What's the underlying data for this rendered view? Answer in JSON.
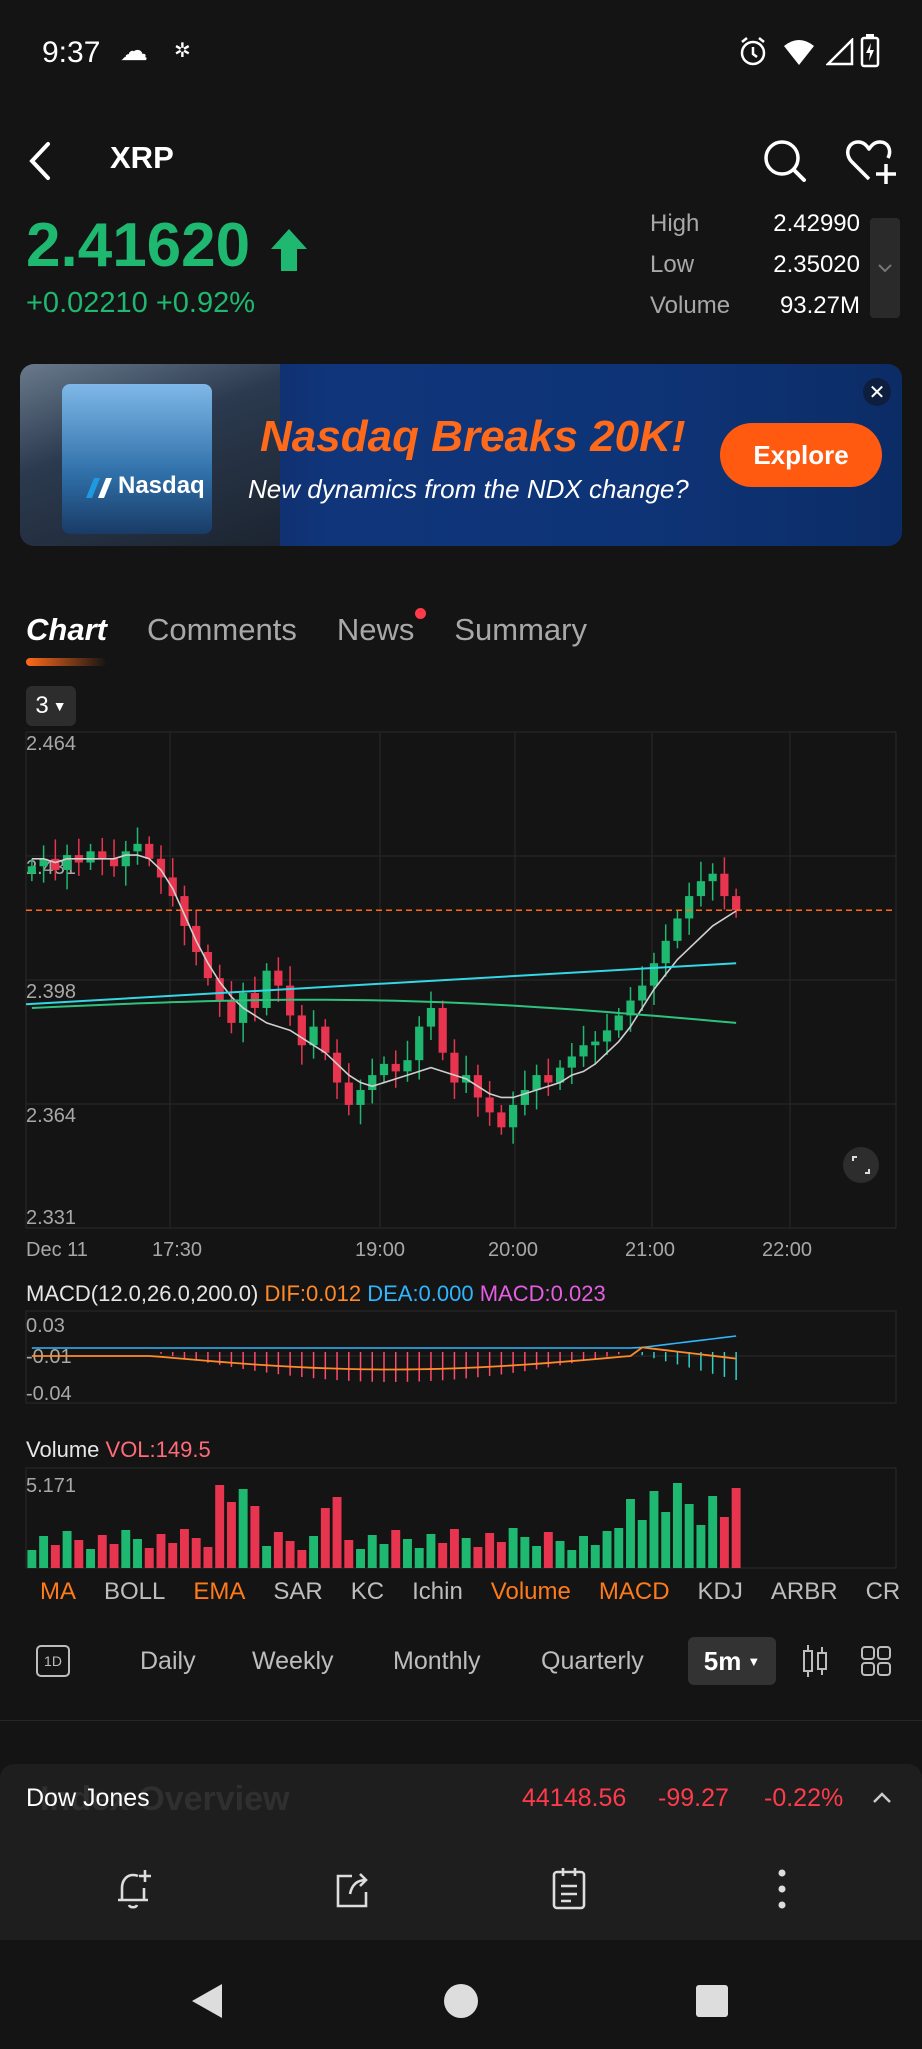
{
  "status_bar": {
    "time": "9:37"
  },
  "header": {
    "title": "XRP"
  },
  "quote": {
    "price": "2.41620",
    "change": "+0.02210 +0.92%",
    "stats": [
      {
        "label": "High",
        "value": "2.42990"
      },
      {
        "label": "Low",
        "value": "2.35020"
      },
      {
        "label": "Volume",
        "value": "93.27M"
      }
    ]
  },
  "banner": {
    "brand": "Nasdaq",
    "headline": "Nasdaq Breaks 20K!",
    "subline": "New dynamics from the NDX change?",
    "button": "Explore"
  },
  "tabs": [
    "Chart",
    "Comments",
    "News",
    "Summary"
  ],
  "chart_selector": "3",
  "chart_data": {
    "type": "candlestick",
    "y_ticks": [
      "2.464",
      "2.431",
      "2.398",
      "2.364",
      "2.331"
    ],
    "x_ticks": [
      "Dec 11",
      "17:30",
      "19:00",
      "20:00",
      "21:00",
      "22:00"
    ],
    "ylim": [
      2.331,
      2.464
    ],
    "current_price": 2.4162,
    "closes": [
      2.428,
      2.43,
      2.427,
      2.431,
      2.429,
      2.432,
      2.43,
      2.428,
      2.432,
      2.434,
      2.43,
      2.425,
      2.42,
      2.412,
      2.405,
      2.398,
      2.392,
      2.386,
      2.394,
      2.39,
      2.4,
      2.396,
      2.388,
      2.38,
      2.385,
      2.378,
      2.37,
      2.364,
      2.368,
      2.372,
      2.375,
      2.373,
      2.376,
      2.385,
      2.39,
      2.378,
      2.37,
      2.372,
      2.366,
      2.362,
      2.358,
      2.364,
      2.368,
      2.372,
      2.37,
      2.374,
      2.377,
      2.38,
      2.381,
      2.384,
      2.388,
      2.392,
      2.396,
      2.402,
      2.408,
      2.414,
      2.42,
      2.424,
      2.426,
      2.42,
      2.4162
    ],
    "ma_fast": [
      2.43,
      2.43,
      2.429,
      2.43,
      2.43,
      2.43,
      2.43,
      2.43,
      2.431,
      2.431,
      2.43,
      2.427,
      2.422,
      2.415,
      2.408,
      2.402,
      2.397,
      2.393,
      2.39,
      2.388,
      2.386,
      2.385,
      2.384,
      2.382,
      2.38,
      2.378,
      2.375,
      2.372,
      2.37,
      2.369,
      2.37,
      2.371,
      2.372,
      2.373,
      2.374,
      2.373,
      2.372,
      2.371,
      2.369,
      2.367,
      2.366,
      2.366,
      2.367,
      2.368,
      2.369,
      2.37,
      2.372,
      2.373,
      2.375,
      2.378,
      2.381,
      2.385,
      2.39,
      2.395,
      2.399,
      2.403,
      2.406,
      2.409,
      2.412,
      2.414,
      2.416
    ],
    "ma_mid_range": [
      2.391,
      2.402
    ],
    "ma_slow_range": [
      2.39,
      2.386
    ]
  },
  "macd": {
    "label": "MACD(12.0,26.0,200.0)",
    "dif": "DIF:0.012",
    "dea": "DEA:0.000",
    "macd": "MACD:0.023",
    "ticks": [
      "0.03",
      "-0.01",
      "-0.04"
    ]
  },
  "volume": {
    "label": "Volume",
    "vol": "VOL:149.5",
    "tick": "5.171"
  },
  "indicators": [
    {
      "label": "MA",
      "active": true
    },
    {
      "label": "BOLL",
      "active": false
    },
    {
      "label": "EMA",
      "active": true
    },
    {
      "label": "SAR",
      "active": false
    },
    {
      "label": "KC",
      "active": false
    },
    {
      "label": "Ichin",
      "active": false
    },
    {
      "label": "Volume",
      "active": true
    },
    {
      "label": "MACD",
      "active": true
    },
    {
      "label": "KDJ",
      "active": false
    },
    {
      "label": "ARBR",
      "active": false
    },
    {
      "label": "CR",
      "active": false
    }
  ],
  "periods": {
    "one_day": "1D",
    "daily": "Daily",
    "weekly": "Weekly",
    "monthly": "Monthly",
    "quarterly": "Quarterly",
    "interval": "5m"
  },
  "ticker": {
    "name": "Dow Jones",
    "ghost": "Index Overview",
    "value": "44148.56",
    "change": "-99.27",
    "pct": "-0.22%"
  },
  "colors": {
    "up": "#1fb870",
    "down": "#e8354f",
    "accent": "#ff6a1a",
    "bg": "#141414"
  }
}
